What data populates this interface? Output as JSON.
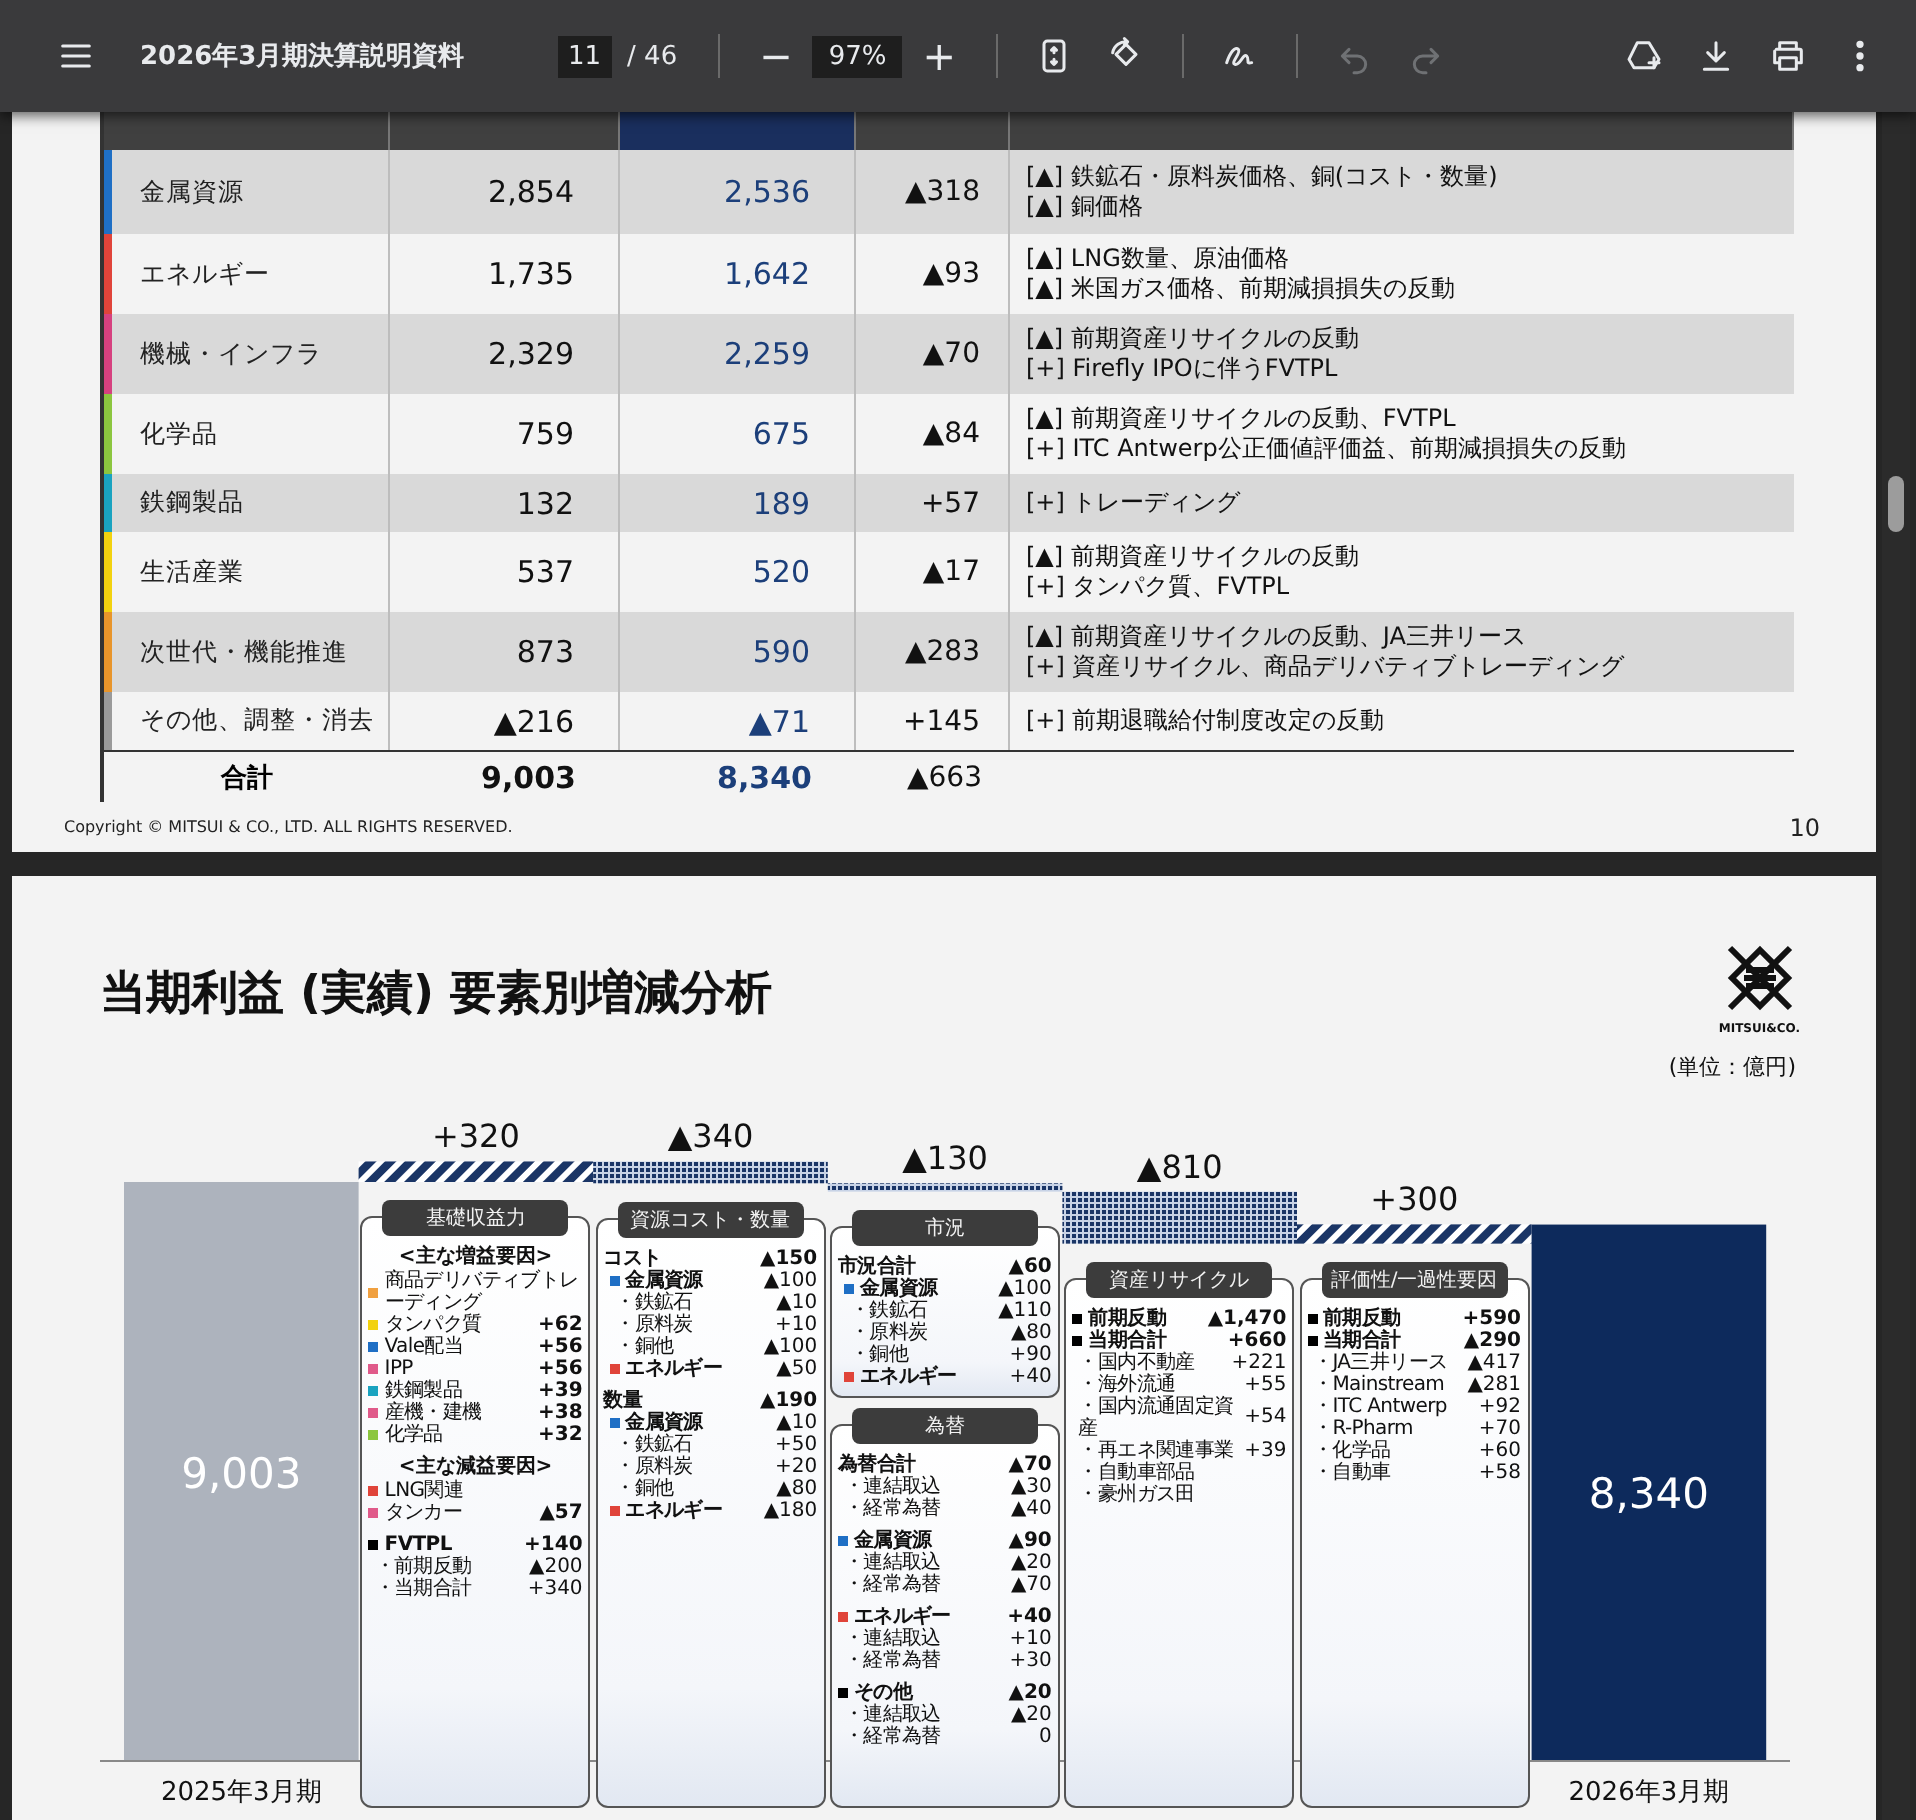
{
  "toolbar": {
    "title": "2026年3月期決算説明資料",
    "page": "11",
    "page_total": "/ 46",
    "zoom_out": "−",
    "zoom": "97%",
    "zoom_in": "+",
    "view_tools": [
      {
        "disabled": false
      },
      {
        "disabled": false
      }
    ],
    "edit_tools": [
      {
        "disabled": false
      }
    ],
    "history_tools": [
      {
        "disabled": true
      },
      {
        "disabled": true
      }
    ],
    "file_tools": [
      {
        "disabled": false
      },
      {
        "disabled": false
      },
      {
        "disabled": false
      },
      {
        "disabled": false
      }
    ]
  },
  "page1": {
    "table": {
      "rows": [
        {
          "segment": "金属資源",
          "color": "#1f6fc5",
          "fy2025": "2,854",
          "fy2026": "2,536",
          "change": "▲318",
          "factors": [
            "[▲] 鉄鉱石・原料炭価格、銅(コスト・数量)",
            "[▲] 銅価格"
          ]
        },
        {
          "segment": "エネルギー",
          "color": "#e0443a",
          "fy2025": "1,735",
          "fy2026": "1,642",
          "change": "▲93",
          "factors": [
            "[▲] LNG数量、原油価格",
            "[▲] 米国ガス価格、前期減損損失の反動"
          ]
        },
        {
          "segment": "機械・インフラ",
          "color": "#d6417f",
          "fy2025": "2,329",
          "fy2026": "2,259",
          "change": "▲70",
          "factors": [
            "[▲] 前期資産リサイクルの反動",
            "[+] Firefly IPOに伴うFVTPL"
          ]
        },
        {
          "segment": "化学品",
          "color": "#8cc63f",
          "fy2025": "759",
          "fy2026": "675",
          "change": "▲84",
          "factors": [
            "[▲] 前期資産リサイクルの反動、FVTPL",
            "[+] ITC Antwerp公正価値評価益、前期減損損失の反動"
          ]
        },
        {
          "segment": "鉄鋼製品",
          "color": "#1aa3c0",
          "fy2025": "132",
          "fy2026": "189",
          "change": "+57",
          "factors": [
            "[+] トレーディング"
          ]
        },
        {
          "segment": "生活産業",
          "color": "#f2d20f",
          "fy2025": "537",
          "fy2026": "520",
          "change": "▲17",
          "factors": [
            "[▲] 前期資産リサイクルの反動",
            "[+] タンパク質、FVTPL"
          ]
        },
        {
          "segment": "次世代・機能推進",
          "color": "#e8952b",
          "fy2025": "873",
          "fy2026": "590",
          "change": "▲283",
          "factors": [
            "[▲] 前期資産リサイクルの反動、JA三井リース",
            "[+] 資産リサイクル、商品デリバティブトレーディング"
          ]
        },
        {
          "segment": "その他、調整・消去",
          "color": "#9a9a9a",
          "fy2025": "▲216",
          "fy2026": "▲71",
          "change": "+145",
          "factors": [
            "[+] 前期退職給付制度改定の反動"
          ]
        }
      ],
      "total": {
        "label": "合計",
        "fy2025": "9,003",
        "fy2026": "8,340",
        "change": "▲663"
      }
    },
    "copyright": "Copyright © MITSUI & CO., LTD. ALL RIGHTS RESERVED.",
    "page_number": "10"
  },
  "page2": {
    "title": "当期利益 (実績) 要素別増減分析",
    "logo_text": "MITSUI&CO.",
    "unit": "(単位：億円)",
    "waterfall": {
      "bars": [
        {
          "kind": "total",
          "value_label": "9,003",
          "category": "2025年3月期"
        },
        {
          "kind": "increase",
          "value_label": "+320"
        },
        {
          "kind": "decrease",
          "value_label": "▲340"
        },
        {
          "kind": "decrease",
          "value_label": "▲130"
        },
        {
          "kind": "decrease",
          "value_label": "▲810"
        },
        {
          "kind": "increase",
          "value_label": "+300"
        },
        {
          "kind": "total",
          "value_label": "8,340",
          "category": "2026年3月期"
        }
      ]
    },
    "breakdown_columns": [
      {
        "boxes": [
          {
            "title": "基礎収益力",
            "groups": [
              [
                {
                  "kind": "heading",
                  "label": "<主な増益要因>"
                },
                {
                  "kind": "item",
                  "label": "商品デリバティブトレーディング",
                  "color": "#f0a040",
                  "bold": false
                },
                {
                  "kind": "item",
                  "label": "タンパク質",
                  "value": "+62",
                  "color": "#f2d20f",
                  "bold": false
                },
                {
                  "kind": "item",
                  "label": "Vale配当",
                  "value": "+56",
                  "color": "#1f6fc5",
                  "bold": false
                },
                {
                  "kind": "item",
                  "label": "IPP",
                  "value": "+56",
                  "color": "#e05a8a",
                  "bold": false
                },
                {
                  "kind": "item",
                  "label": "鉄鋼製品",
                  "value": "+39",
                  "color": "#1aa3c0",
                  "bold": false
                },
                {
                  "kind": "item",
                  "label": "産機・建機",
                  "value": "+38",
                  "color": "#e05a8a",
                  "bold": false
                },
                {
                  "kind": "item",
                  "label": "化学品",
                  "value": "+32",
                  "color": "#8cc63f",
                  "bold": false
                }
              ],
              [
                {
                  "kind": "heading",
                  "label": "<主な減益要因>"
                },
                {
                  "kind": "item",
                  "label": "LNG関連",
                  "color": "#e0443a",
                  "bold": false
                },
                {
                  "kind": "item",
                  "label": "タンカー",
                  "value": "▲57",
                  "color": "#e05a8a",
                  "bold": false
                }
              ],
              [
                {
                  "kind": "item",
                  "label": "FVTPL",
                  "value": "+140",
                  "color": "#000000",
                  "bold": true,
                  "children": [
                    {
                      "kind": "item",
                      "label": "・前期反動",
                      "value": "▲200",
                      "bold": false
                    },
                    {
                      "kind": "item",
                      "label": "・当期合計",
                      "value": "+340",
                      "bold": false
                    }
                  ]
                }
              ]
            ]
          }
        ]
      },
      {
        "boxes": [
          {
            "title": "資源コスト・数量",
            "groups": [
              [
                {
                  "kind": "item",
                  "label": "コスト",
                  "value": "▲150",
                  "bold": true,
                  "children": [
                    {
                      "kind": "item",
                      "label": "金属資源",
                      "value": "▲100",
                      "color": "#1f6fc5",
                      "bold": true,
                      "children": [
                        {
                          "kind": "item",
                          "label": "・鉄鉱石",
                          "value": "▲10",
                          "bold": false
                        },
                        {
                          "kind": "item",
                          "label": "・原料炭",
                          "value": "+10",
                          "bold": false
                        },
                        {
                          "kind": "item",
                          "label": "・銅他",
                          "value": "▲100",
                          "bold": false
                        }
                      ]
                    },
                    {
                      "kind": "item",
                      "label": "エネルギー",
                      "value": "▲50",
                      "color": "#e0443a",
                      "bold": true
                    }
                  ]
                }
              ],
              [
                {
                  "kind": "item",
                  "label": "数量",
                  "value": "▲190",
                  "bold": true,
                  "children": [
                    {
                      "kind": "item",
                      "label": "金属資源",
                      "value": "▲10",
                      "color": "#1f6fc5",
                      "bold": true,
                      "children": [
                        {
                          "kind": "item",
                          "label": "・鉄鉱石",
                          "value": "+50",
                          "bold": false
                        },
                        {
                          "kind": "item",
                          "label": "・原料炭",
                          "value": "+20",
                          "bold": false
                        },
                        {
                          "kind": "item",
                          "label": "・銅他",
                          "value": "▲80",
                          "bold": false
                        }
                      ]
                    },
                    {
                      "kind": "item",
                      "label": "エネルギー",
                      "value": "▲180",
                      "color": "#e0443a",
                      "bold": true
                    }
                  ]
                }
              ]
            ]
          }
        ]
      },
      {
        "boxes": [
          {
            "title": "市況",
            "groups": [
              [
                {
                  "kind": "item",
                  "label": "市況合計",
                  "value": "▲60",
                  "bold": true,
                  "children": [
                    {
                      "kind": "item",
                      "label": "金属資源",
                      "value": "▲100",
                      "color": "#1f6fc5",
                      "bold": true,
                      "children": [
                        {
                          "kind": "item",
                          "label": "・鉄鉱石",
                          "value": "▲110",
                          "bold": false
                        },
                        {
                          "kind": "item",
                          "label": "・原料炭",
                          "value": "▲80",
                          "bold": false
                        },
                        {
                          "kind": "item",
                          "label": "・銅他",
                          "value": "+90",
                          "bold": false
                        }
                      ]
                    },
                    {
                      "kind": "item",
                      "label": "エネルギー",
                      "value": "+40",
                      "color": "#e0443a",
                      "bold": true
                    }
                  ]
                }
              ]
            ]
          },
          {
            "title": "為替",
            "groups": [
              [
                {
                  "kind": "item",
                  "label": "為替合計",
                  "value": "▲70",
                  "bold": true,
                  "children": [
                    {
                      "kind": "item",
                      "label": "・連結取込",
                      "value": "▲30",
                      "bold": false
                    },
                    {
                      "kind": "item",
                      "label": "・経常為替",
                      "value": "▲40",
                      "bold": false
                    }
                  ]
                }
              ],
              [
                {
                  "kind": "item",
                  "label": "金属資源",
                  "value": "▲90",
                  "color": "#1f6fc5",
                  "bold": true,
                  "children": [
                    {
                      "kind": "item",
                      "label": "・連結取込",
                      "value": "▲20",
                      "bold": false
                    },
                    {
                      "kind": "item",
                      "label": "・経常為替",
                      "value": "▲70",
                      "bold": false
                    }
                  ]
                }
              ],
              [
                {
                  "kind": "item",
                  "label": "エネルギー",
                  "value": "+40",
                  "color": "#e0443a",
                  "bold": true,
                  "children": [
                    {
                      "kind": "item",
                      "label": "・連結取込",
                      "value": "+10",
                      "bold": false
                    },
                    {
                      "kind": "item",
                      "label": "・経常為替",
                      "value": "+30",
                      "bold": false
                    }
                  ]
                }
              ],
              [
                {
                  "kind": "item",
                  "label": "その他",
                  "value": "▲20",
                  "color": "#000000",
                  "bold": true,
                  "children": [
                    {
                      "kind": "item",
                      "label": "・連結取込",
                      "value": "▲20",
                      "bold": false
                    },
                    {
                      "kind": "item",
                      "label": "・経常為替",
                      "value": "0",
                      "bold": false
                    }
                  ]
                }
              ]
            ]
          }
        ]
      },
      {
        "boxes": [
          {
            "title": "資産リサイクル",
            "groups": [
              [
                {
                  "kind": "item",
                  "label": "前期反動",
                  "value": "▲1,470",
                  "color": "#000000",
                  "bold": true
                },
                {
                  "kind": "item",
                  "label": "当期合計",
                  "value": "+660",
                  "color": "#000000",
                  "bold": true,
                  "children": [
                    {
                      "kind": "item",
                      "label": "・国内不動産",
                      "value": "+221",
                      "bold": false
                    },
                    {
                      "kind": "item",
                      "label": "・海外流通",
                      "value": "+55",
                      "bold": false
                    },
                    {
                      "kind": "item",
                      "label": "・国内流通固定資産",
                      "value": "+54",
                      "bold": false
                    },
                    {
                      "kind": "item",
                      "label": "・再エネ関連事業",
                      "value": "+39",
                      "bold": false
                    },
                    {
                      "kind": "item",
                      "label": "・自動車部品",
                      "bold": false
                    },
                    {
                      "kind": "item",
                      "label": "・豪州ガス田",
                      "bold": false
                    }
                  ]
                }
              ]
            ]
          }
        ]
      },
      {
        "boxes": [
          {
            "title": "評価性/一過性要因",
            "groups": [
              [
                {
                  "kind": "item",
                  "label": "前期反動",
                  "value": "+590",
                  "color": "#000000",
                  "bold": true
                },
                {
                  "kind": "item",
                  "label": "当期合計",
                  "value": "▲290",
                  "color": "#000000",
                  "bold": true,
                  "children": [
                    {
                      "kind": "item",
                      "label": "・JA三井リース",
                      "value": "▲417",
                      "bold": false
                    },
                    {
                      "kind": "item",
                      "label": "・Mainstream",
                      "value": "▲281",
                      "bold": false
                    },
                    {
                      "kind": "item",
                      "label": "・ITC Antwerp",
                      "value": "+92",
                      "bold": false
                    },
                    {
                      "kind": "item",
                      "label": "・R-Pharm",
                      "value": "+70",
                      "bold": false
                    },
                    {
                      "kind": "item",
                      "label": "・化学品",
                      "value": "+60",
                      "bold": false
                    },
                    {
                      "kind": "item",
                      "label": "・自動車",
                      "value": "+58",
                      "bold": false
                    }
                  ]
                }
              ]
            ]
          }
        ]
      }
    ]
  }
}
